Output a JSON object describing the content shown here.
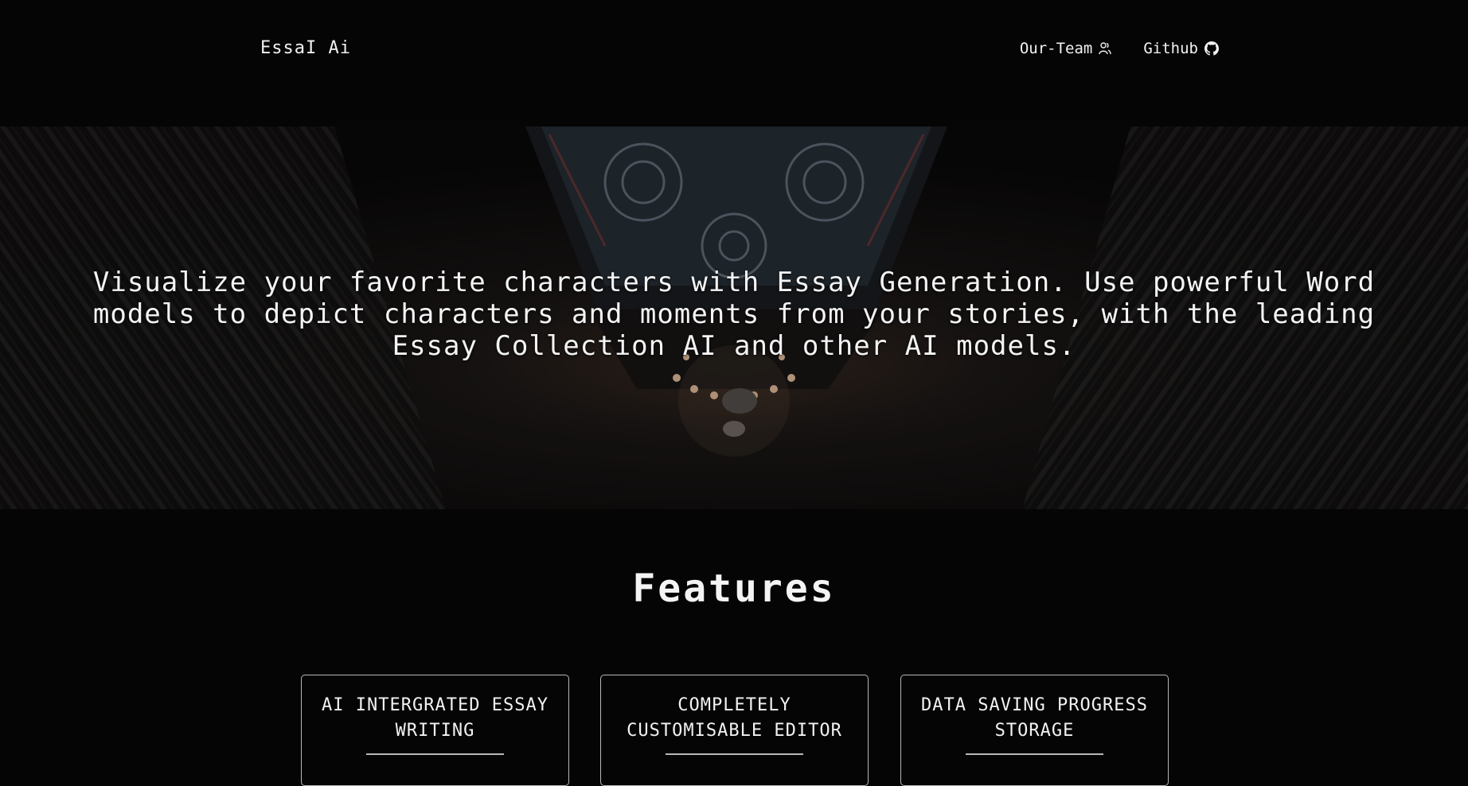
{
  "navbar": {
    "brand": "EssaI Ai",
    "links": [
      {
        "label": "Our-Team",
        "icon": "team-icon"
      },
      {
        "label": "Github",
        "icon": "github-icon"
      }
    ]
  },
  "hero": {
    "background_image": "library-ceiling-photo",
    "tagline": "Visualize your favorite characters with Essay Generation. Use powerful Word models to depict characters and moments from your stories, with the leading Essay Collection AI and other AI models."
  },
  "features": {
    "title": "Features",
    "cards": [
      {
        "title": "AI INTERGRATED ESSAY WRITING"
      },
      {
        "title": "COMPLETELY CUSTOMISABLE EDITOR"
      },
      {
        "title": "DATA SAVING PROGRESS STORAGE"
      }
    ]
  },
  "colors": {
    "background": "#050505",
    "text": "#f4f4f4",
    "card_border": "#b8b8b8"
  }
}
